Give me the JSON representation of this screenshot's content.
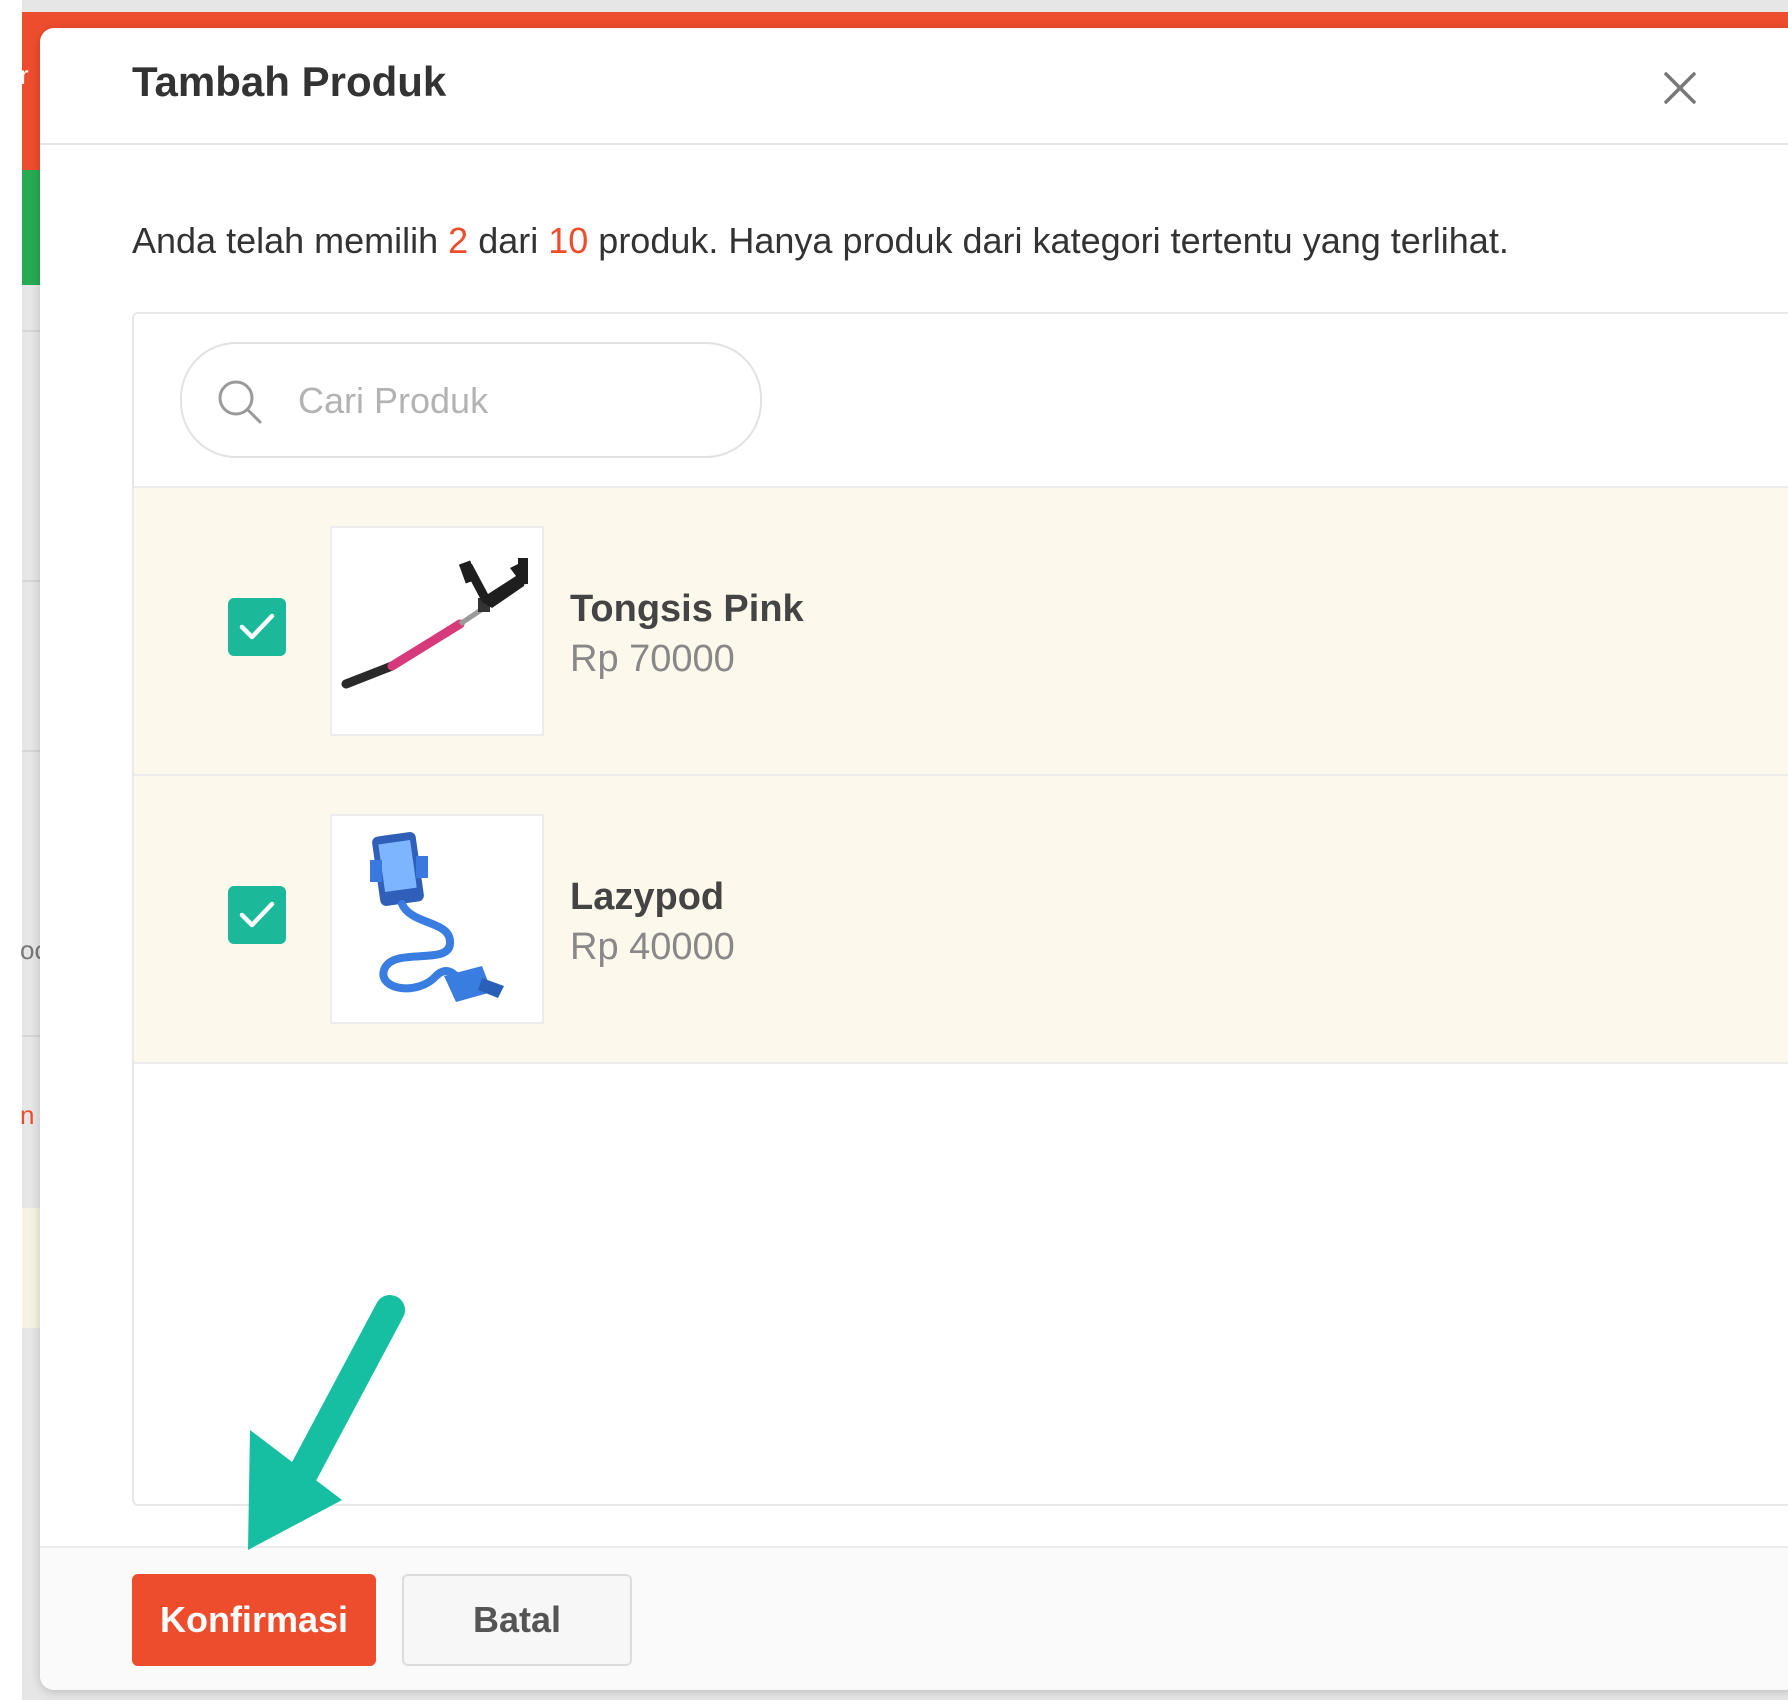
{
  "background": {
    "peek_top": "r",
    "peek_mid": "oc",
    "peek_low": "n"
  },
  "modal": {
    "title": "Tambah Produk",
    "info": {
      "prefix": "Anda telah memilih ",
      "selected": "2",
      "middle": " dari ",
      "max": "10",
      "suffix": " produk.  Hanya produk dari kategori tertentu yang terlihat."
    },
    "search": {
      "placeholder": "Cari Produk",
      "value": ""
    },
    "products": [
      {
        "name": "Tongsis Pink",
        "price": "Rp 70000",
        "checked": true,
        "icon": "selfie-stick-image"
      },
      {
        "name": "Lazypod",
        "price": "Rp 40000",
        "checked": true,
        "icon": "lazypod-phone-holder-image"
      }
    ],
    "footer": {
      "confirm_label": "Konfirmasi",
      "cancel_label": "Batal"
    }
  },
  "colors": {
    "accent": "#ee4d2d",
    "checkbox": "#1bb99a",
    "row_highlight": "#fcf9ec",
    "annotation_arrow": "#16bfa2"
  },
  "annotation": {
    "icon": "pointer-arrow-icon"
  }
}
